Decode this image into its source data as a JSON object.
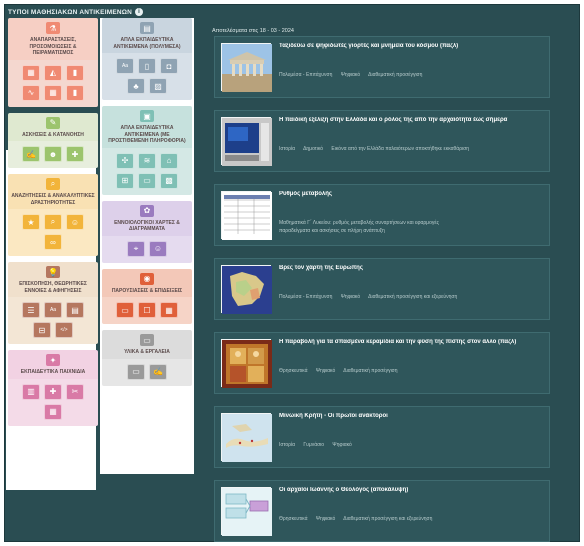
{
  "app": {
    "title": "ΤΥΠΟΙ ΜΑΘΗΣΙΑΚΩΝ ΑΝΤΙΚΕΙΜΕΝΩΝ",
    "info_icon": "info-icon"
  },
  "left_categories": [
    {
      "label": "ΑΝΑΠΑΡΑΣΤΑΣΕΙΣ, ΠΡΟΣΟΜΟΙΩΣΕΙΣ & ΠΕΙΡΑΜΑΤΙΣΜΟΣ",
      "head_bg": "#f6cfc4",
      "body_bg": "#f4d7cf",
      "tile_bg": "#f08a73",
      "icon": "flask-icon",
      "tiles": [
        "chart-icon",
        "bucket-icon",
        "bar-chart-icon",
        "wave-icon",
        "chart-icon",
        "bar-chart-icon"
      ]
    },
    {
      "label": "ΑΣΚΗΣΕΙΣ & ΚΑΤΑΝΟΗΣΗ",
      "head_bg": "#dfe9d0",
      "body_bg": "#e7eedd",
      "tile_bg": "#9cc46d",
      "icon": "pencil-icon",
      "tiles": [
        "edit-icon",
        "people-icon",
        "puzzle-icon"
      ]
    },
    {
      "label": "ΑΝΑΖΗΤΗΣΕΙΣ & ΑΝΑΚΑΛΥΠΤΙΚΕΣ ΔΡΑΣΤΗΡΙΟΤΗΤΕΣ",
      "head_bg": "#f9e1b3",
      "body_bg": "#fbe8c2",
      "tile_bg": "#f2b43a",
      "icon": "search-icon",
      "tiles": [
        "star-icon",
        "search-icon",
        "person-icon",
        "binoculars-icon"
      ]
    },
    {
      "label": "ΕΠΙΣΚΟΠΗΣΗ, ΘΕΩΡΗΤΙΚΕΣ ΕΝΝΟΙΕΣ & ΑΦΗΓΗΣΕΙΣ",
      "head_bg": "#f0e0cc",
      "body_bg": "#f3e6d5",
      "tile_bg": "#b5775f",
      "icon": "bulb-icon",
      "tiles": [
        "list-icon",
        "text-icon",
        "document-icon",
        "timeline-icon",
        "code-icon"
      ]
    },
    {
      "label": "ΕΚΠΑΙΔΕΥΤΙΚΑ ΠΑΙΧΝΙΔΙΑ",
      "head_bg": "#f2d2e3",
      "body_bg": "#f4dbe8",
      "tile_bg": "#d97aa6",
      "icon": "game-icon",
      "tiles": [
        "cards-icon",
        "puzzle-icon",
        "scissors-icon",
        "board-icon"
      ]
    }
  ],
  "mid_categories": [
    {
      "label": "ΑΠΛΑ ΕΚΠΑΙΔΕΥΤΙΚΑ ΑΝΤΙΚΕΙΜΕΝΑ (ΠΟΛΥΜΕΣΑ)",
      "head_bg": "#c9d5df",
      "body_bg": "#d7e0e8",
      "tile_bg": "#8fa3b3",
      "icon": "document-icon",
      "tiles": [
        "text-icon",
        "page-icon",
        "camera-icon",
        "tree-icon",
        "image-icon"
      ]
    },
    {
      "label": "ΑΠΛΑ ΕΚΠΑΙΔΕΥΤΙΚΑ ΑΝΤΙΚΕΙΜΕΝΑ (ΜΕ ΠΡΟΣΤΙΘΕΜΕΝΗ ΠΛΗΡΟΦΟΡΙΑ)",
      "head_bg": "#c6e1dd",
      "body_bg": "#d4e8e5",
      "tile_bg": "#7fc0b5",
      "icon": "box-icon",
      "tiles": [
        "network-icon",
        "wifi-icon",
        "building-icon",
        "layout-icon",
        "slides-icon",
        "gallery-icon"
      ]
    },
    {
      "label": "ΕΝΝΟΙΟΛΟΓΙΚΟΙ ΧΑΡΤΕΣ & ΔΙΑΓΡΑΜΜΑΤΑ",
      "head_bg": "#ddd0ea",
      "body_bg": "#e5dbef",
      "tile_bg": "#9a7bbf",
      "icon": "mindmap-icon",
      "tiles": [
        "map-icon",
        "person-icon"
      ]
    },
    {
      "label": "ΠΑΡΟΥΣΙΑΣΕΙΣ & ΕΠΙΔΕΙΞΕΙΣ",
      "head_bg": "#f3c8b8",
      "body_bg": "#f6d4c7",
      "tile_bg": "#e0603a",
      "icon": "eye-icon",
      "tiles": [
        "monitor-icon",
        "chat-icon",
        "board-icon"
      ]
    },
    {
      "label": "ΥΛΙΚΑ & ΕΡΓΑΛΕΙΑ",
      "head_bg": "#dcdcdc",
      "body_bg": "#e6e6e6",
      "tile_bg": "#9a9a9a",
      "icon": "window-icon",
      "tiles": [
        "window-icon",
        "edit-icon"
      ]
    }
  ],
  "feed": {
    "date_line": "Αποτελέσματα στις 18 - 03 - 2024",
    "cards": [
      {
        "title": "Ταξιδεύω σε ψηφιδωτές γιορτές και μνημεία του κόσμου (παζλ)",
        "meta": "Πολυμέσα - Επιτάχυνση      Ψηφιακό      Διαθεματική προσέγγιση",
        "thumb": "temple"
      },
      {
        "title": "Η παιδική εξέλιξη στην Ελλάδα και ο ρόλος της από την αρχαιότητα έως σήμερα",
        "meta": "Ιστορία      Δημοτικό      Εικόνα από την Ελλάδα παλαιότερων αποκτήθηκε εκκαθάριση",
        "thumb": "software"
      },
      {
        "title": "Ρυθμός μεταβολής",
        "meta": "Μαθηματικά Γ΄ Λυκείου: ρυθμός μεταβολής συναρτήσεων και εφαρμογές\nπαραδείγματα και ασκήσεις σε πλήρη ανάπτυξη",
        "thumb": "table"
      },
      {
        "title": "Βρες τον χάρτη της Ευρώπης",
        "meta": "Πολυμέσα - Επιτάχυνση      Ψηφιακό      Διαθεματική προσέγγιση και εξερεύνηση",
        "thumb": "map"
      },
      {
        "title": "Η παραβολή για τα σπασμένα κεραμίδια και την φύση της πίστης στον άλλο (παζλ)",
        "meta": "Θρησκευτικά      Ψηφιακό      Διαθεματική προσέγγιση",
        "thumb": "icon"
      },
      {
        "title": "Μινωική Κρήτη - Οι πρώτοι ανάκτοροι",
        "meta": "Ιστορία      Γυμνάσιο      Ψηφιακό",
        "thumb": "crete"
      },
      {
        "title": "Οι αρχαίοι Ιωάννης ο Θεολόγος (αποκάλυψη)",
        "meta": "Θρησκευτικά      Ψηφιακό      Διαθεματική προσέγγιση και εξερεύνηση",
        "thumb": "diagram"
      }
    ]
  }
}
